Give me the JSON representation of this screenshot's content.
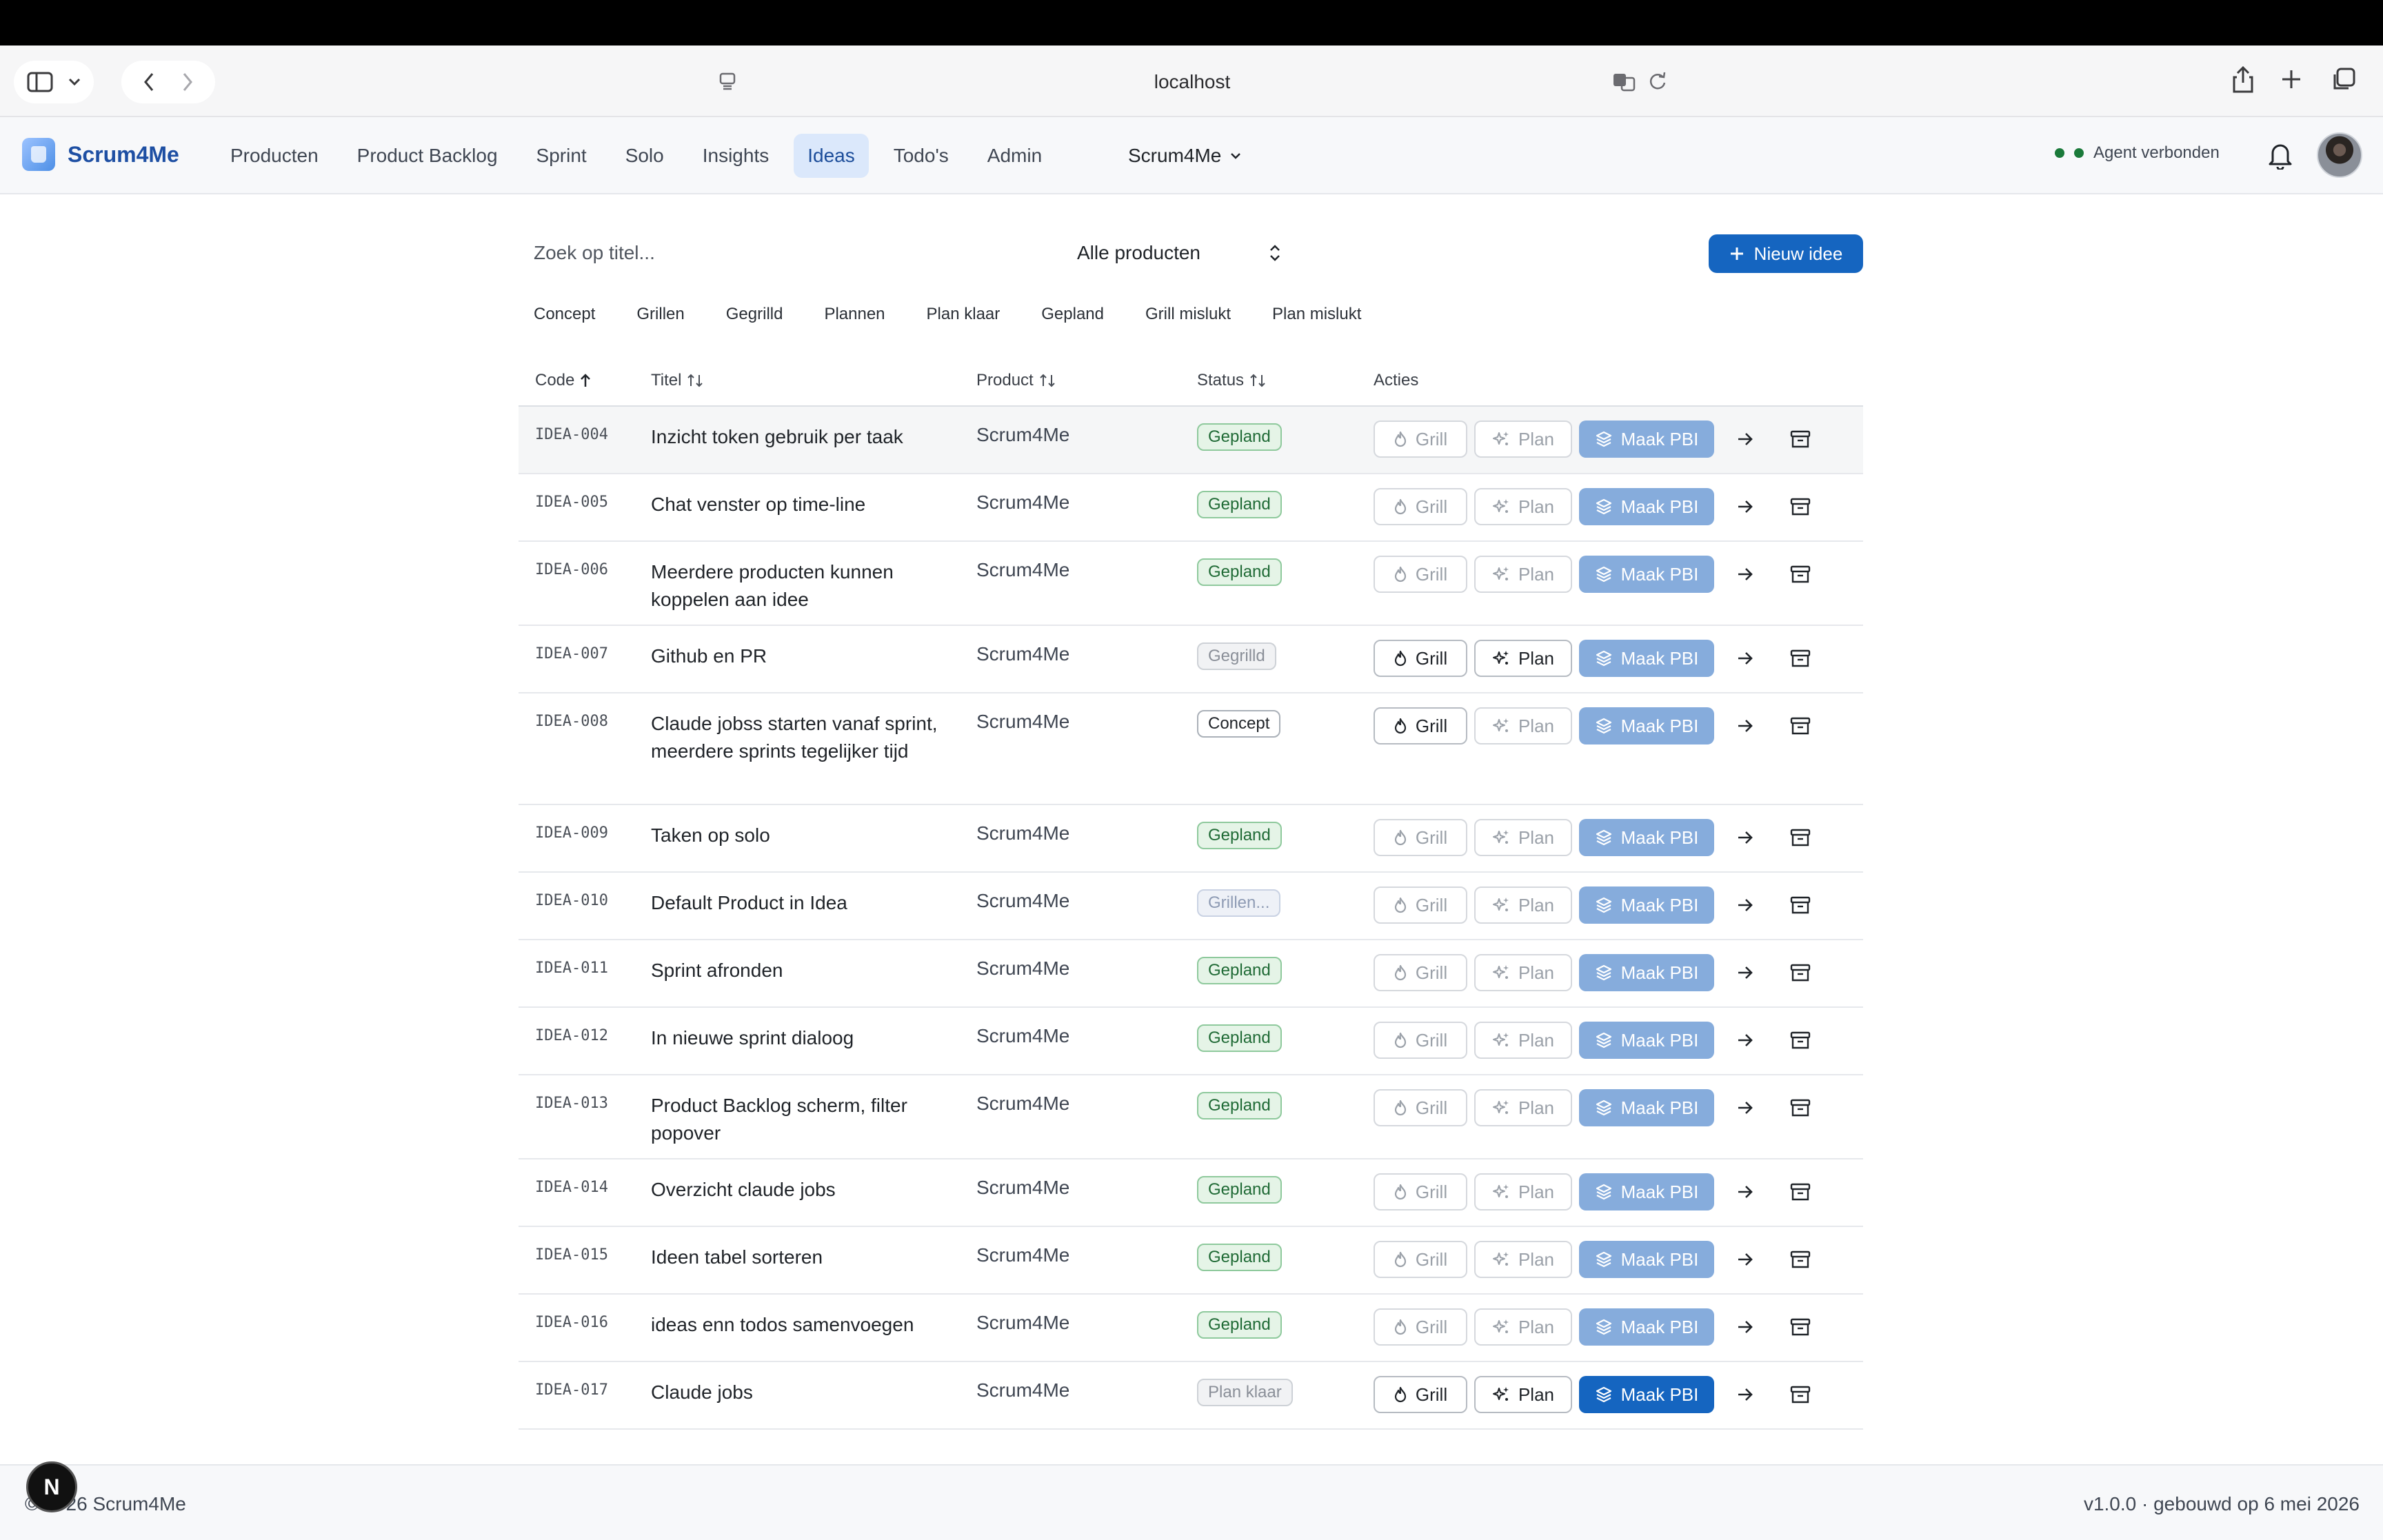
{
  "browser": {
    "url": "localhost"
  },
  "app": {
    "brand": "Scrum4Me",
    "nav": [
      "Producten",
      "Product Backlog",
      "Sprint",
      "Solo",
      "Insights",
      "Ideas",
      "Todo's",
      "Admin"
    ],
    "active_nav": "Ideas",
    "product_switcher": "Scrum4Me",
    "agent_status": "Agent verbonden",
    "agent_status_color": "#1a7a3a"
  },
  "toolbar": {
    "search_placeholder": "Zoek op titel...",
    "product_filter": "Alle producten",
    "new_button": "Nieuw idee",
    "status_chips": [
      "Concept",
      "Grillen",
      "Gegrilld",
      "Plannen",
      "Plan klaar",
      "Gepland",
      "Grill mislukt",
      "Plan mislukt"
    ]
  },
  "table": {
    "columns": [
      "Code",
      "Titel",
      "Product",
      "Status",
      "Acties"
    ],
    "rows": [
      {
        "code": "IDEA-004",
        "title": "Inzicht token gebruik per taak",
        "product": "Scrum4Me",
        "status": "Gepland"
      },
      {
        "code": "IDEA-005",
        "title": "Chat venster op time-line",
        "product": "Scrum4Me",
        "status": "Gepland"
      },
      {
        "code": "IDEA-006",
        "title": "Meerdere producten kunnen koppelen aan idee",
        "product": "Scrum4Me",
        "status": "Gepland"
      },
      {
        "code": "IDEA-007",
        "title": "Github en PR",
        "product": "Scrum4Me",
        "status": "Gegrilld"
      },
      {
        "code": "IDEA-008",
        "title": "Claude jobss starten vanaf sprint, meerdere sprints tegelijker tijd",
        "product": "Scrum4Me",
        "status": "Concept"
      },
      {
        "code": "IDEA-009",
        "title": "Taken op solo",
        "product": "Scrum4Me",
        "status": "Gepland"
      },
      {
        "code": "IDEA-010",
        "title": "Default Product in Idea",
        "product": "Scrum4Me",
        "status": "Grillen..."
      },
      {
        "code": "IDEA-011",
        "title": "Sprint afronden",
        "product": "Scrum4Me",
        "status": "Gepland"
      },
      {
        "code": "IDEA-012",
        "title": "In nieuwe sprint dialoog",
        "product": "Scrum4Me",
        "status": "Gepland"
      },
      {
        "code": "IDEA-013",
        "title": "Product Backlog scherm, filter popover",
        "product": "Scrum4Me",
        "status": "Gepland"
      },
      {
        "code": "IDEA-014",
        "title": "Overzicht claude jobs",
        "product": "Scrum4Me",
        "status": "Gepland"
      },
      {
        "code": "IDEA-015",
        "title": "Ideen tabel sorteren",
        "product": "Scrum4Me",
        "status": "Gepland"
      },
      {
        "code": "IDEA-016",
        "title": "ideas enn todos samenvoegen",
        "product": "Scrum4Me",
        "status": "Gepland"
      },
      {
        "code": "IDEA-017",
        "title": "Claude jobs",
        "product": "Scrum4Me",
        "status": "Plan klaar"
      }
    ],
    "actions": {
      "grill": "Grill",
      "plan": "Plan",
      "pbi": "Maak PBI"
    }
  },
  "footer": {
    "left": "© 2026 Scrum4Me",
    "right": "v1.0.0 · gebouwd op 6 mei 2026",
    "dev_badge": "N"
  }
}
